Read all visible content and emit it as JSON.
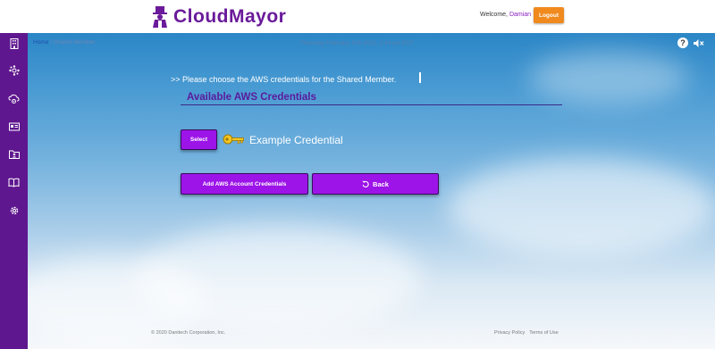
{
  "header": {
    "brand": "CloudMayor",
    "welcome_prefix": "Welcome,",
    "user_name": "Damian",
    "logout_label": "Logout",
    "brand_color": "#6a1a9a",
    "logout_color": "#f08a1e"
  },
  "sidebar": {
    "bg_color": "#5f178f",
    "items": [
      {
        "icon": "building-icon"
      },
      {
        "icon": "network-icon"
      },
      {
        "icon": "cloud-gear-icon"
      },
      {
        "icon": "id-card-icon"
      },
      {
        "icon": "folder-user-icon"
      },
      {
        "icon": "book-icon"
      },
      {
        "icon": "settings-gear-icon"
      }
    ]
  },
  "topbar": {
    "breadcrumb_home": "Home",
    "breadcrumb_separator": "/",
    "breadcrumb_current": "Shared Member",
    "datetime": "Thursday February 11th 2021, 2:44 pm EST"
  },
  "main": {
    "prompt": ">> Please choose the AWS credentials for the Shared Member.",
    "section_title": "Available AWS Credentials",
    "credentials": [
      {
        "select_label": "Select",
        "name": "Example Credential"
      }
    ],
    "add_button_label": "Add AWS Account Credentials",
    "back_button_label": "Back",
    "accent_color": "#9c14e8"
  },
  "footer": {
    "copyright": "© 2020 Danitech Corporation, Inc.",
    "privacy": "Privacy Policy",
    "terms": "Terms of Use"
  }
}
